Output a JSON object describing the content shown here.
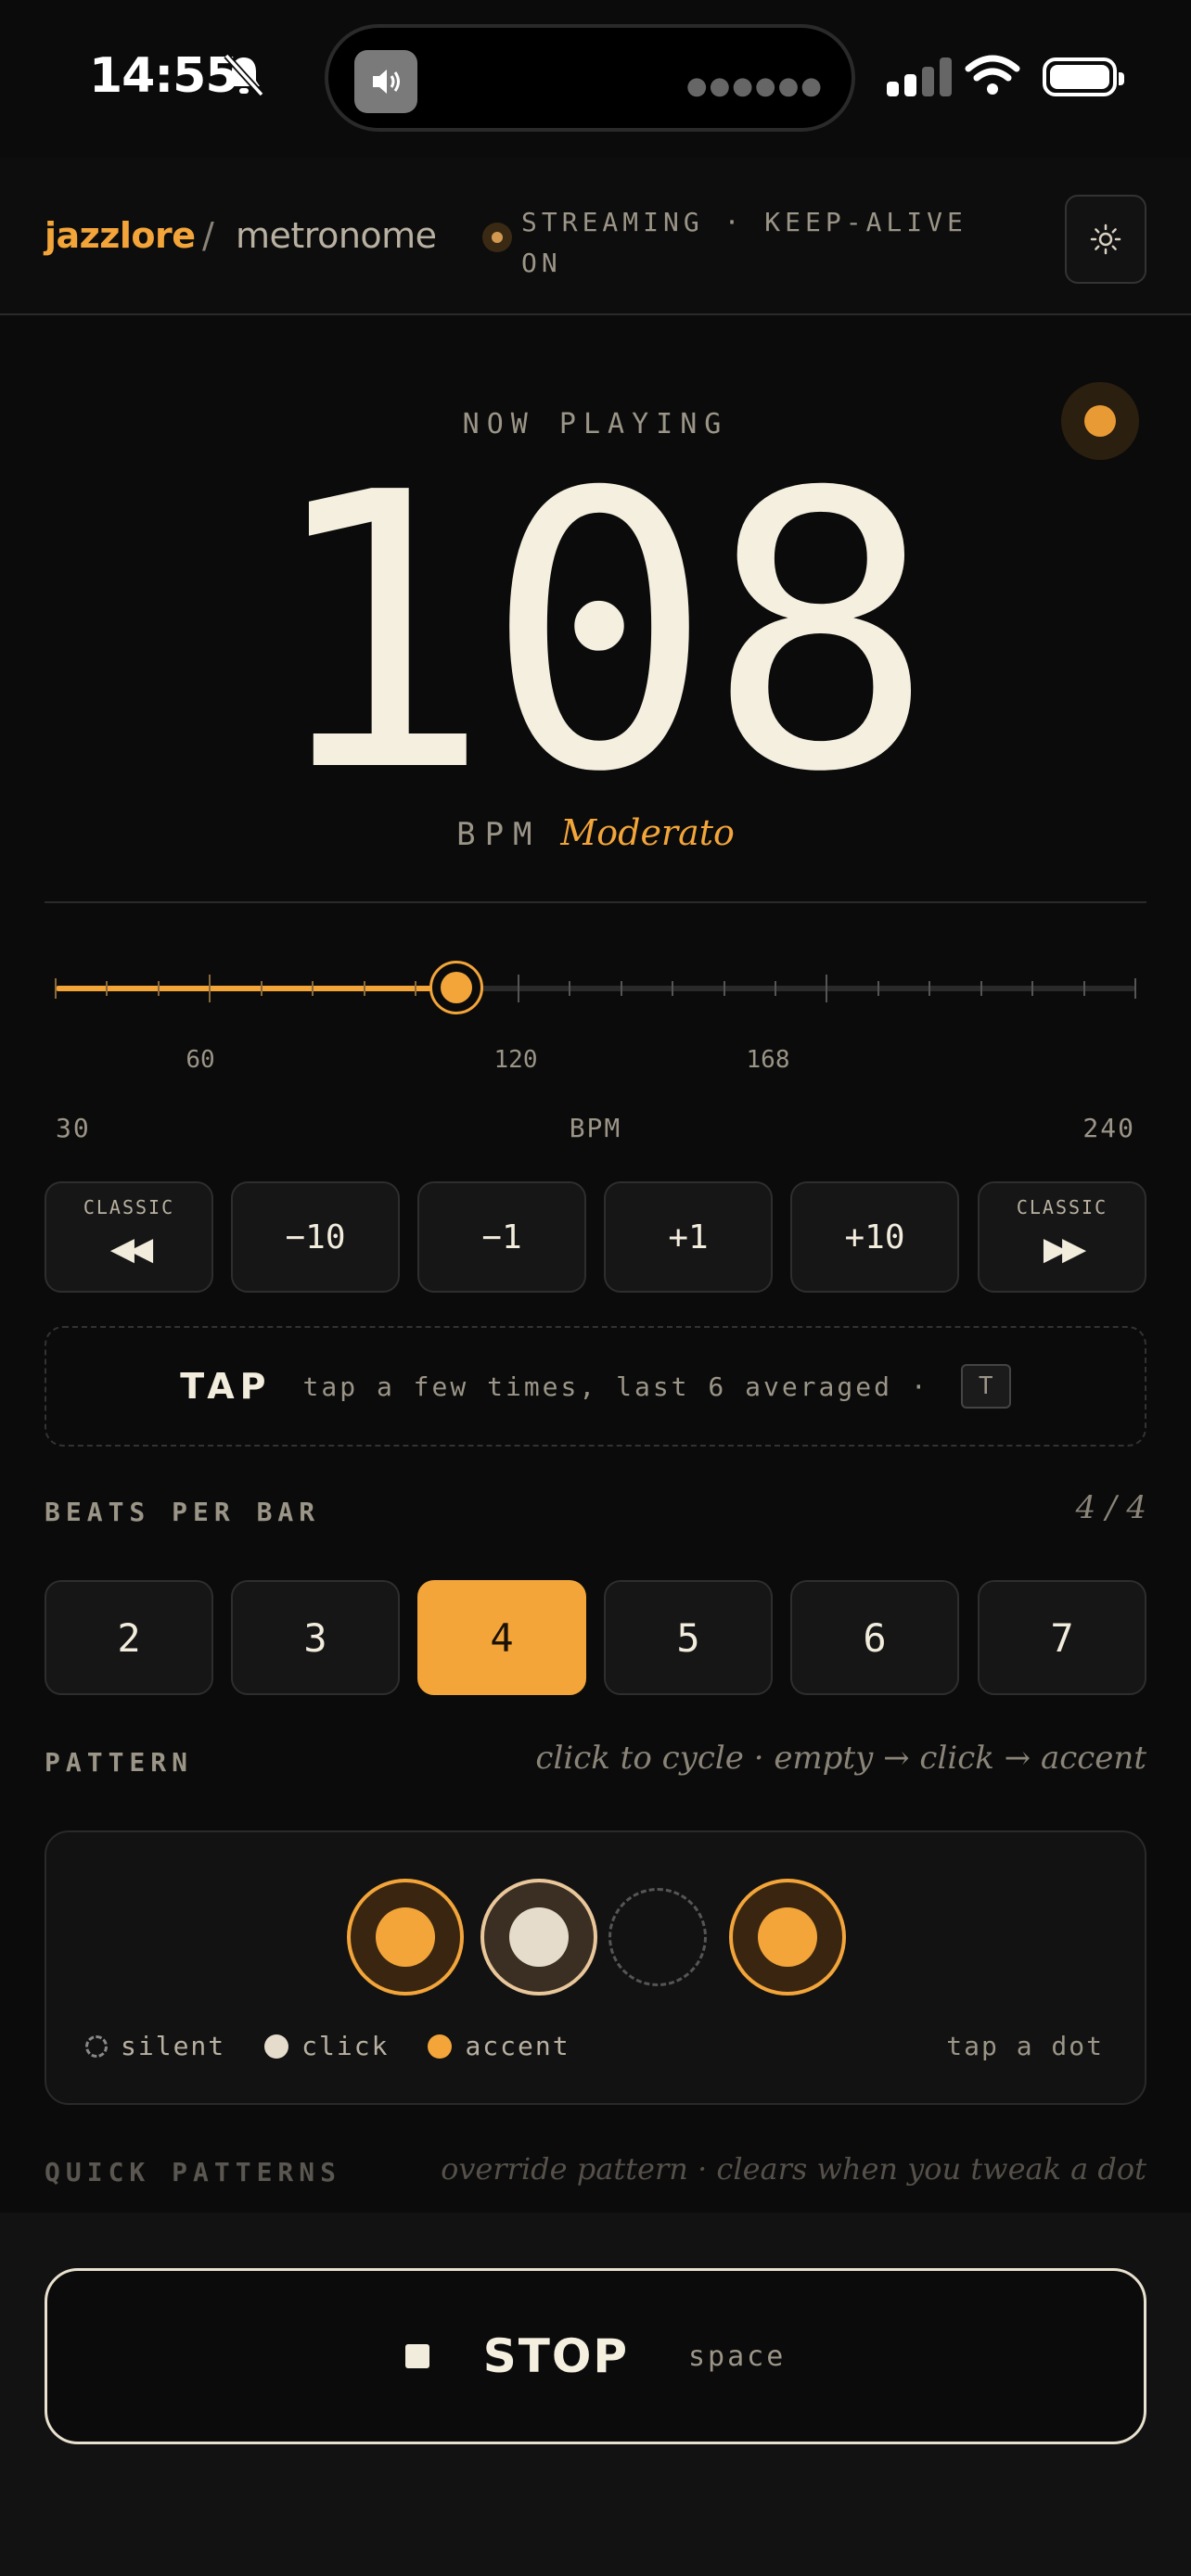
{
  "status_bar": {
    "time": "14:55"
  },
  "header": {
    "brand": "jazzlore",
    "separator": "/",
    "crumb": "metronome",
    "streaming_status": "STREAMING · KEEP-ALIVE ON"
  },
  "now_playing": {
    "label": "NOW PLAYING",
    "bpm": "108",
    "unit": "BPM",
    "tempo_name": "Moderato"
  },
  "slider": {
    "min": 30,
    "max": 240,
    "value": 108,
    "tick_labels": [
      "60",
      "120",
      "168"
    ],
    "min_label": "30",
    "center_label": "BPM",
    "max_label": "240"
  },
  "steps": {
    "classic_label": "CLASSIC",
    "back_classic": "◀◀",
    "minus10": "−10",
    "minus1": "−1",
    "plus1": "+1",
    "plus10": "+10",
    "fwd_classic": "▶▶"
  },
  "tap": {
    "label": "TAP",
    "hint": "tap a few times, last 6 averaged ·",
    "key": "T"
  },
  "beats_per_bar": {
    "title": "BEATS PER BAR",
    "signature": "4 / 4",
    "options": [
      "2",
      "3",
      "4",
      "5",
      "6",
      "7"
    ],
    "selected": "4"
  },
  "pattern": {
    "title": "PATTERN",
    "aside": "click to cycle · empty → click → accent",
    "dots": [
      "accent",
      "click",
      "empty",
      "accent"
    ],
    "legend": {
      "silent": "silent",
      "click": "click",
      "accent": "accent"
    },
    "hint": "tap a dot"
  },
  "quick_patterns": {
    "title": "QUICK PATTERNS",
    "aside": "override pattern · clears when you tweak a dot"
  },
  "transport": {
    "stop_label": "STOP",
    "shortcut": "space"
  },
  "colors": {
    "accent": "#f3a53a",
    "background": "#0b0b0b",
    "text": "#f2ecdd"
  }
}
